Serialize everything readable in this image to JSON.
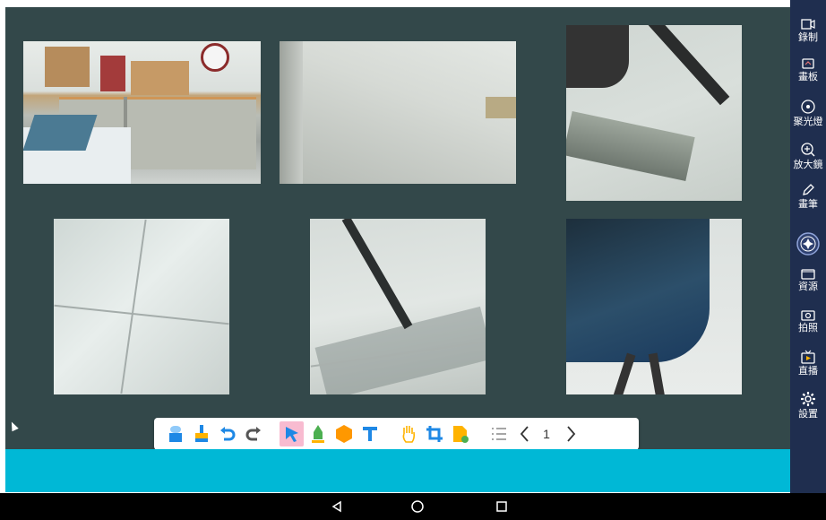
{
  "sidebar": {
    "items": [
      {
        "label": "錄制",
        "icon": "record-icon"
      },
      {
        "label": "畫板",
        "icon": "whiteboard-icon"
      },
      {
        "label": "聚光燈",
        "icon": "spotlight-icon"
      },
      {
        "label": "放大鏡",
        "icon": "magnifier-icon"
      },
      {
        "label": "畫筆",
        "icon": "pen-icon"
      },
      {
        "label": "",
        "icon": "navigation-joystick-icon"
      },
      {
        "label": "資源",
        "icon": "resource-icon"
      },
      {
        "label": "拍照",
        "icon": "camera-icon"
      },
      {
        "label": "直播",
        "icon": "live-icon"
      },
      {
        "label": "設置",
        "icon": "settings-icon"
      }
    ]
  },
  "toolbar": {
    "page_number": "1",
    "tools": [
      "eraser-icon",
      "clear-icon",
      "undo-icon",
      "redo-icon",
      "select-icon",
      "highlighter-icon",
      "shape-icon",
      "text-icon",
      "hand-icon",
      "crop-icon",
      "add-page-icon",
      "list-icon",
      "prev-page-icon",
      "next-page-icon"
    ]
  },
  "navbar": {
    "buttons": [
      "back-icon",
      "home-icon",
      "recents-icon"
    ]
  },
  "colors": {
    "canvas": "#33484a",
    "sidebar": "#1f2e4f",
    "accent_bar": "#00b8d6",
    "toolbar_blue": "#1e88e5",
    "toolbar_green": "#4caf50",
    "toolbar_orange": "#ff9800"
  }
}
